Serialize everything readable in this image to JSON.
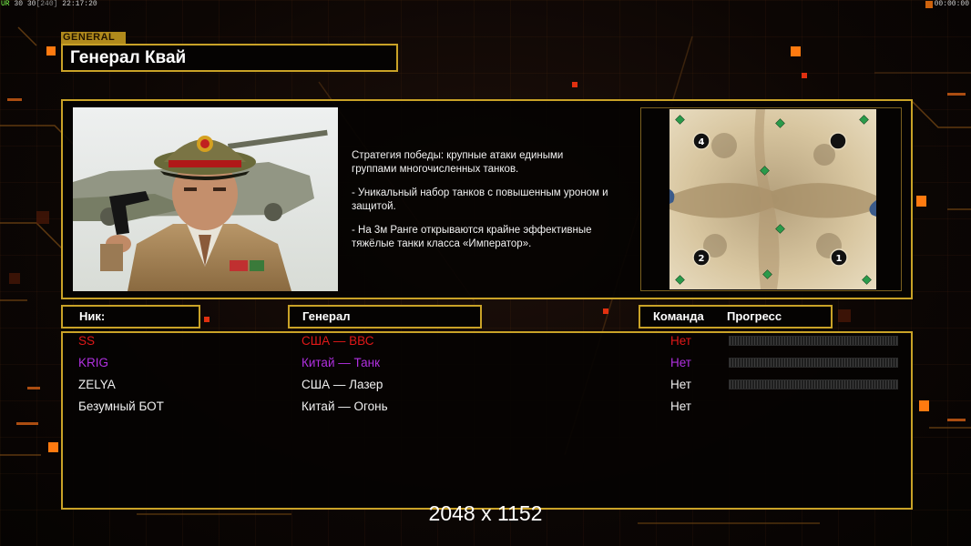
{
  "debug": {
    "left_a": "UR",
    "left_b": "30 30",
    "left_c": "[240]",
    "left_d": "22:17:20",
    "right": "00:00:00"
  },
  "general_tag": "GENERAL",
  "general_name": "Генерал Квай",
  "description": [
    "Стратегия победы: крупные атаки едиными\n группами многочисленных танков.",
    "- Уникальный набор танков с повышенным уроном и\n  защитой.",
    "- На 3м Ранге открываются крайне эффективные\n  тяжёлые танки класса «Император»."
  ],
  "map": {
    "start_positions": [
      "4",
      "2",
      "1"
    ]
  },
  "columns": {
    "nick": "Ник:",
    "general": "Генерал",
    "team": "Команда",
    "progress": "Прогресс"
  },
  "players": [
    {
      "nick": "SS",
      "general": "США — ВВС",
      "team": "Нет",
      "color": "#e01818",
      "progress": 0,
      "show_bar": true
    },
    {
      "nick": "KRIG",
      "general": "Китай — Танк",
      "team": "Нет",
      "color": "#b030e0",
      "progress": 0,
      "show_bar": true
    },
    {
      "nick": "ZELYA",
      "general": "США — Лазер",
      "team": "Нет",
      "color": "#f0f0f0",
      "progress": 0,
      "show_bar": true
    },
    {
      "nick": "Безумный БОТ",
      "general": "Китай — Огонь",
      "team": "Нет",
      "color": "#f0f0f0",
      "progress": 0,
      "show_bar": false
    }
  ],
  "resolution_text": "2048 x 1152",
  "colors": {
    "frame": "#c9a227",
    "accent_orange": "#ff8a1a",
    "accent_red": "#e03010"
  }
}
